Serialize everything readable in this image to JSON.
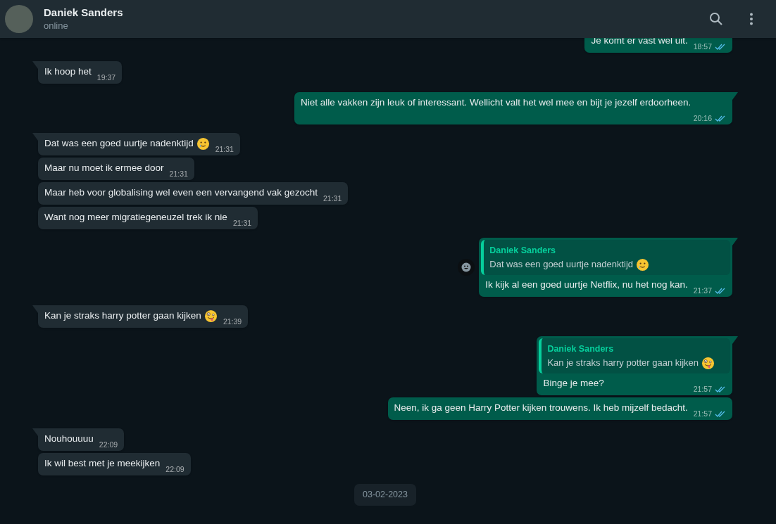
{
  "header": {
    "name": "Daniek Sanders",
    "status": "online"
  },
  "messages": [
    {
      "kind": "outgoing",
      "tail": false,
      "text": "Je komt er vast wel uit.",
      "time": "18:57",
      "read": true
    },
    {
      "kind": "incoming",
      "tail": true,
      "text": "Ik hoop het",
      "time": "19:37"
    },
    {
      "kind": "outgoing",
      "tail": true,
      "text": "Niet alle vakken zijn leuk of interessant. Wellicht valt het wel mee en bijt je jezelf erdoorheen.",
      "time": "20:16",
      "read": true
    },
    {
      "kind": "incoming",
      "tail": true,
      "text": "Dat was een goed uurtje nadenktijd",
      "emoji": {
        "kind": "tear"
      },
      "time": "21:31"
    },
    {
      "kind": "incoming",
      "tail": false,
      "text": "Maar nu moet ik ermee door",
      "time": "21:31"
    },
    {
      "kind": "incoming",
      "tail": false,
      "text": "Maar heb voor globalising wel even een vervangend vak gezocht",
      "time": "21:31"
    },
    {
      "kind": "incoming",
      "tail": false,
      "text": "Want nog meer migratiegeneuzel trek ik nie",
      "time": "21:31"
    },
    {
      "kind": "outgoing",
      "tail": true,
      "reaction_button": true,
      "quote": {
        "author": "Daniek Sanders",
        "text": "Dat was een goed uurtje nadenktijd",
        "emoji": {
          "kind": "tear"
        }
      },
      "text": "Ik kijk al een goed uurtje Netflix, nu het nog kan.",
      "time": "21:37",
      "read": true
    },
    {
      "kind": "incoming",
      "tail": true,
      "text": "Kan je straks harry potter gaan kijken",
      "emoji": {
        "kind": "zany"
      },
      "time": "21:39"
    },
    {
      "kind": "outgoing",
      "tail": true,
      "quote": {
        "author": "Daniek Sanders",
        "text": "Kan je straks harry potter gaan kijken",
        "emoji": {
          "kind": "zany"
        }
      },
      "text": "Binge je mee?",
      "time": "21:57",
      "read": true
    },
    {
      "kind": "outgoing",
      "tail": false,
      "text": "Neen, ik ga geen Harry Potter kijken trouwens. Ik heb mijzelf bedacht.",
      "time": "21:57",
      "read": true
    },
    {
      "kind": "incoming",
      "tail": true,
      "text": "Nouhouuuu",
      "time": "22:09"
    },
    {
      "kind": "incoming",
      "tail": false,
      "text": "Ik wil best met je meekijken",
      "time": "22:09"
    }
  ],
  "date_chip": "03-02-2023"
}
